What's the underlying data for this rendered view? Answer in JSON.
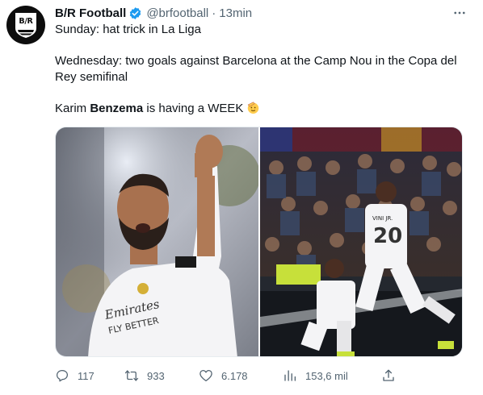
{
  "tweet": {
    "author": {
      "name": "B/R Football",
      "handle": "@brfootball",
      "avatar_text": "B/R",
      "verified_badge": "verified-badge-icon"
    },
    "separator": "·",
    "time": "13min",
    "more_label": "···",
    "text": {
      "line1": "Sunday: hat trick in La Liga",
      "line2": "Wednesday: two goals against Barcelona at the Camp Nou in the Copa del Rey semifinal",
      "line3_before": "Karim ",
      "line3_bold": "Benzema",
      "line3_after": " is having a WEEK",
      "emoji": "saluting-face-emoji"
    },
    "media": [
      {
        "icon": "photo-benzema-celebrating",
        "description_colors": [
          "#f5f5f7",
          "#2a1f1a"
        ]
      },
      {
        "icon": "photo-celebration-camp-nou",
        "jersey_text": "VINI JR.",
        "jersey_number": "20",
        "sponsor_text": "Emirates FLY BETTER"
      }
    ],
    "actions": {
      "reply_count": "117",
      "retweet_count": "933",
      "like_count": "6.178",
      "views_count": "153,6 mil"
    }
  },
  "colors": {
    "text_primary": "#0f1419",
    "text_secondary": "#536471",
    "verified": "#1d9bf0",
    "background": "#ffffff"
  }
}
